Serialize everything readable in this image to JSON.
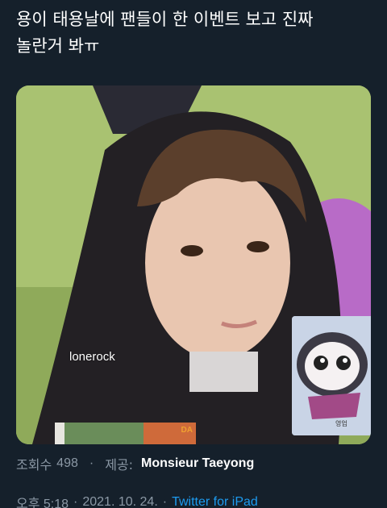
{
  "tweet": {
    "text_line1": "용이 태용날에 팬들이 한 이벤트 보고 진짜",
    "text_line2": "놀란거 봐ㅠ"
  },
  "media": {
    "overlay_label": "lonerock",
    "thumb_caption": "영업",
    "thumb_tag": "DA"
  },
  "meta": {
    "views_label": "조회수",
    "views_count": "498",
    "dot": "·",
    "source_label": "제공:",
    "source_name": "Monsieur Taeyong"
  },
  "time": {
    "time": "오후 5:18",
    "date": "2021. 10. 24.",
    "sep": "·",
    "client": "Twitter for iPad"
  },
  "colors": {
    "background": "#15202b",
    "secondary_text": "#8b98a5",
    "link": "#1d9bf0"
  }
}
